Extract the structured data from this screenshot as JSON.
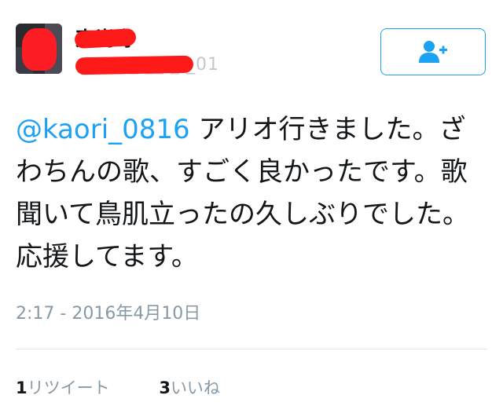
{
  "user": {
    "display_name": "東尚寿",
    "handle": "@___ _ __ _ _01"
  },
  "follow_button": {
    "icon": "add-user-icon",
    "color": "#1da1f2"
  },
  "tweet": {
    "mention": "@kaori_0816",
    "text": " アリオ行きました。ざわちんの歌、すごく良かったです。歌聞いて鳥肌立ったの久しぶりでした。応援してます。"
  },
  "timestamp": "2:17 - 2016年4月10日",
  "stats": {
    "retweets_count": "1",
    "retweets_label": "リツイート",
    "likes_count": "3",
    "likes_label": "いいね"
  }
}
